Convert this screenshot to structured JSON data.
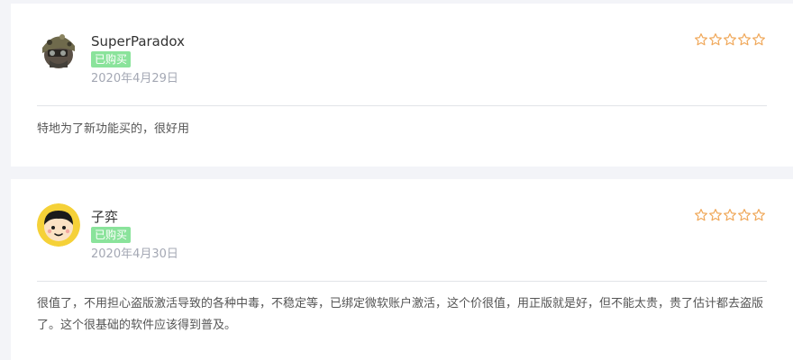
{
  "reviews": [
    {
      "user": "SuperParadox",
      "badge": "已购买",
      "date": "2020年4月29日",
      "rating": 0,
      "content": "特地为了新功能买的，很好用",
      "avatar_icon": "military-helmet-avatar-icon"
    },
    {
      "user": "子弈",
      "badge": "已购买",
      "date": "2020年4月30日",
      "rating": 0,
      "content": "很值了，不用担心盗版激活导致的各种中毒，不稳定等，已绑定微软账户激活，这个价很值，用正版就是好，但不能太贵，贵了估计都去盗版了。这个很基础的软件应该得到普及。",
      "avatar_icon": "cartoon-face-avatar-icon"
    }
  ],
  "colors": {
    "star_outline": "#f0a85a",
    "badge_bg": "#8ae39b",
    "page_bg": "#f3f4f8"
  }
}
